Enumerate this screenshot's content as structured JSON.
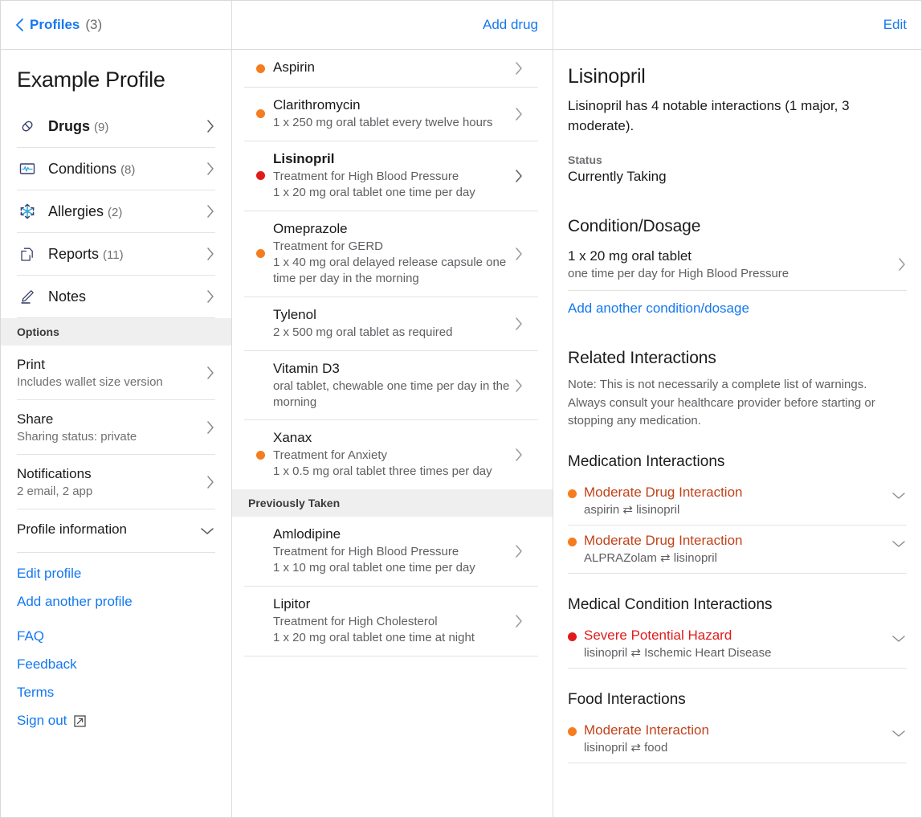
{
  "colors": {
    "blue": "#1478f0",
    "orange": "#f57c1f",
    "red": "#e01b1b",
    "severe_text": "#e01b1b",
    "moderate_text": "#c1431a",
    "icon_navy": "#3b3f6b",
    "icon_cyan": "#3aaae1"
  },
  "sidebar": {
    "back": {
      "label": "Profiles",
      "count": "(3)",
      "icon": "chevron-left-icon"
    },
    "profile_title": "Example Profile",
    "nav": [
      {
        "label": "Drugs",
        "count": "(9)",
        "icon": "pill-icon",
        "bold": true
      },
      {
        "label": "Conditions",
        "count": "(8)",
        "icon": "vitals-icon",
        "bold": false
      },
      {
        "label": "Allergies",
        "count": "(2)",
        "icon": "snowflake-icon",
        "bold": false
      },
      {
        "label": "Reports",
        "count": "(11)",
        "icon": "documents-icon",
        "bold": false
      },
      {
        "label": "Notes",
        "count": "",
        "icon": "pencil-icon",
        "bold": false
      }
    ],
    "options_header": "Options",
    "options": [
      {
        "title": "Print",
        "sub": "Includes wallet size version",
        "chevron": "chevron-right-icon"
      },
      {
        "title": "Share",
        "sub": "Sharing status: private",
        "chevron": "chevron-right-icon"
      },
      {
        "title": "Notifications",
        "sub": "2 email, 2 app",
        "chevron": "chevron-right-icon"
      },
      {
        "title": "Profile information",
        "sub": "",
        "chevron": "chevron-down-icon"
      }
    ],
    "links_primary": [
      {
        "label": "Edit profile"
      },
      {
        "label": "Add another profile"
      }
    ],
    "links_secondary": [
      {
        "label": "FAQ"
      },
      {
        "label": "Feedback"
      },
      {
        "label": "Terms"
      }
    ],
    "signout": {
      "label": "Sign out",
      "icon": "external-link-icon"
    }
  },
  "drug_list": {
    "add_button": "Add drug",
    "current": [
      {
        "name": "Aspirin",
        "bold": false,
        "dot": "orange",
        "lines": []
      },
      {
        "name": "Clarithromycin",
        "bold": false,
        "dot": "orange",
        "lines": [
          "1 x 250 mg oral tablet every twelve hours"
        ]
      },
      {
        "name": "Lisinopril",
        "bold": true,
        "dot": "red",
        "lines": [
          "Treatment for High Blood Pressure",
          "1 x 20 mg oral tablet one time per day"
        ]
      },
      {
        "name": "Omeprazole",
        "bold": false,
        "dot": "orange",
        "lines": [
          "Treatment for GERD",
          "1 x 40 mg oral delayed release capsule one time per day in the morning"
        ]
      },
      {
        "name": "Tylenol",
        "bold": false,
        "dot": "none",
        "lines": [
          "2 x 500 mg oral tablet as required"
        ]
      },
      {
        "name": "Vitamin D3",
        "bold": false,
        "dot": "none",
        "lines": [
          "oral tablet, chewable one time per day in the morning"
        ]
      },
      {
        "name": "Xanax",
        "bold": false,
        "dot": "orange",
        "lines": [
          "Treatment for Anxiety",
          "1 x 0.5 mg oral tablet three times per day"
        ]
      }
    ],
    "previous_header": "Previously Taken",
    "previous": [
      {
        "name": "Amlodipine",
        "bold": false,
        "dot": "none",
        "lines": [
          "Treatment for High Blood Pressure",
          "1 x 10 mg oral tablet one time per day"
        ]
      },
      {
        "name": "Lipitor",
        "bold": false,
        "dot": "none",
        "lines": [
          "Treatment for High Cholesterol",
          "1 x 20 mg oral tablet one time at night"
        ]
      }
    ]
  },
  "detail": {
    "edit_button": "Edit",
    "title": "Lisinopril",
    "summary": "Lisinopril has 4 notable interactions (1 major, 3 moderate).",
    "status_label": "Status",
    "status_value": "Currently Taking",
    "condition_heading": "Condition/Dosage",
    "dosage": {
      "title": "1 x 20 mg oral tablet",
      "sub": "one time per day for High Blood Pressure"
    },
    "add_dosage_link": "Add another condition/dosage",
    "interactions_heading": "Related Interactions",
    "interactions_note": "Note: This is not necessarily a complete list of warnings. Always consult your healthcare provider before starting or stopping any medication.",
    "med_heading": "Medication Interactions",
    "med_interactions": [
      {
        "severity": "Moderate Drug Interaction",
        "level": "moderate",
        "pair": "aspirin ⇄ lisinopril"
      },
      {
        "severity": "Moderate Drug Interaction",
        "level": "moderate",
        "pair": "ALPRAZolam ⇄ lisinopril"
      }
    ],
    "cond_heading": "Medical Condition Interactions",
    "cond_interactions": [
      {
        "severity": "Severe Potential Hazard",
        "level": "severe",
        "pair": "lisinopril ⇄ Ischemic Heart Disease"
      }
    ],
    "food_heading": "Food Interactions",
    "food_interactions": [
      {
        "severity": "Moderate Interaction",
        "level": "moderate",
        "pair": "lisinopril ⇄ food"
      }
    ]
  }
}
